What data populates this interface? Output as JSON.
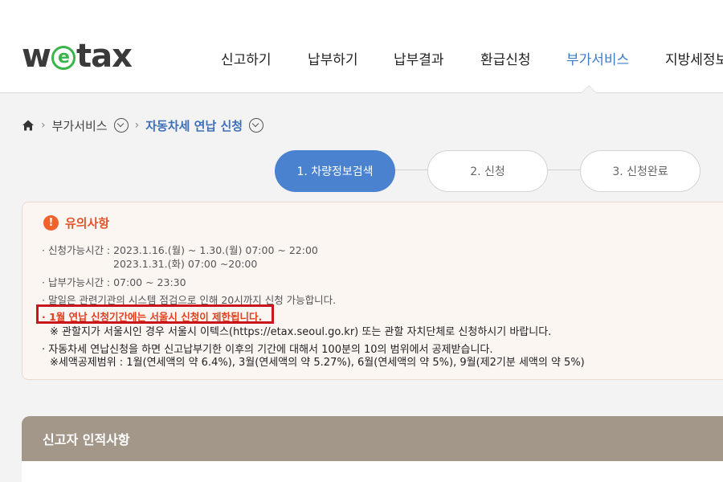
{
  "logo": {
    "part1": "w",
    "e": "e",
    "part2": "tax"
  },
  "nav": {
    "items": [
      {
        "label": "신고하기"
      },
      {
        "label": "납부하기"
      },
      {
        "label": "납부결과"
      },
      {
        "label": "환급신청"
      },
      {
        "label": "부가서비스"
      },
      {
        "label": "지방세정보"
      }
    ],
    "active_index": 4
  },
  "breadcrumb": {
    "level1": "부가서비스",
    "current": "자동차세 연납 신청"
  },
  "steps": [
    {
      "label": "1. 차량정보검색",
      "state": "active"
    },
    {
      "label": "2. 신청",
      "state": "inactive"
    },
    {
      "label": "3. 신청완료",
      "state": "inactive"
    }
  ],
  "notice": {
    "icon": "!",
    "title": "유의사항",
    "lines": [
      "· 신청가능시간 : 2023.1.16.(월) ~ 1.30.(월) 07:00 ~ 22:00",
      "2023.1.31.(화) 07:00 ~20:00",
      "· 납부가능시간 : 07:00 ~ 23:30",
      "· 말일은 관련기관의 시스템 점검으로 인해 20시까지 신청 가능합니다.",
      "· 1월 연납 신청기간에는 서울시 신청이 제한됩니다.",
      "※ 관할지가 서울시인 경우 서울시 이텍스(https://etax.seoul.go.kr) 또는 관할 자치단체로 신청하시기 바랍니다.",
      "· 자동차세 연납신청을 하면 신고납부기한 이후의 기간에 대해서 100분의 10의 범위에서 공제받습니다.",
      "※세액공제범위 : 1월(연세액의 약 6.4%), 3월(연세액의 약 5.27%), 6월(연세액의 약 5%), 9월(제2기분 세액의 약 5%)"
    ]
  },
  "panel": {
    "title": "신고자 인적사항"
  },
  "colors": {
    "accent": "#4a82cf",
    "nav_active": "#3d7cc9",
    "warning": "#e0401e",
    "highlight_box": "#c9161e",
    "panel_header": "#a3978a"
  }
}
